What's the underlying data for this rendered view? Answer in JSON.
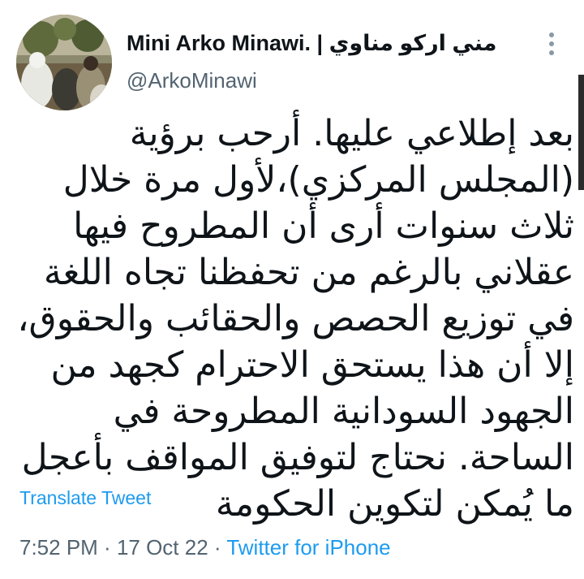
{
  "tweet": {
    "display_name": "Mini Arko Minawi. | مني اركو مناوي",
    "handle": "@ArkoMinawi",
    "text": "بعد إطلاعي عليها. أرحب برؤية (المجلس المركزي)،لأول مرة خلال ثلاث سنوات أرى أن المطروح فيها عقلاني بالرغم من تحفظنا تجاه اللغة في توزيع الحصص والحقائب والحقوق، إلا أن هذا يستحق الاحترام كجهد من الجهود السودانية المطروحة في الساحة. نحتاج لتوفيق المواقف بأعجل ما يُمكن لتكوين الحكومة",
    "translate_label": "Translate Tweet",
    "time": "7:52 PM",
    "date": "17 Oct 22",
    "separator": " · ",
    "source": "Twitter for iPhone"
  },
  "icons": {
    "more": "more-vertical-icon"
  },
  "colors": {
    "link": "#1d9bf0",
    "secondary_text": "#536471",
    "primary_text": "#0f1419"
  }
}
